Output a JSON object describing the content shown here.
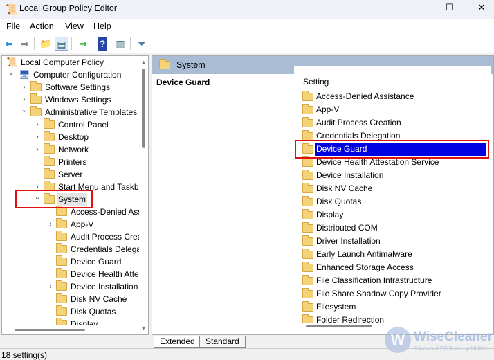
{
  "window": {
    "title": "Local Group Policy Editor",
    "minimize": "—",
    "maximize": "☐",
    "close": "✕"
  },
  "menu": [
    "File",
    "Action",
    "View",
    "Help"
  ],
  "toolbar": {
    "icons": [
      "back-arrow-icon",
      "forward-arrow-icon",
      "up-folder-icon",
      "show-hide-tree-icon",
      "export-list-icon",
      "help-icon",
      "action-pane-icon",
      "filter-icon"
    ]
  },
  "tree": [
    {
      "label": "Local Computer Policy",
      "level": 0,
      "chevron": ""
    },
    {
      "label": "Computer Configuration",
      "level": 1,
      "chevron": "expanded"
    },
    {
      "label": "Software Settings",
      "level": 2,
      "chevron": "collapsed"
    },
    {
      "label": "Windows Settings",
      "level": 2,
      "chevron": "collapsed"
    },
    {
      "label": "Administrative Templates",
      "level": 2,
      "chevron": "expanded"
    },
    {
      "label": "Control Panel",
      "level": 3,
      "chevron": "collapsed"
    },
    {
      "label": "Desktop",
      "level": 3,
      "chevron": "collapsed"
    },
    {
      "label": "Network",
      "level": 3,
      "chevron": "collapsed"
    },
    {
      "label": "Printers",
      "level": 3,
      "chevron": ""
    },
    {
      "label": "Server",
      "level": 3,
      "chevron": ""
    },
    {
      "label": "Start Menu and Taskbar",
      "level": 3,
      "chevron": "collapsed"
    },
    {
      "label": "System",
      "level": 3,
      "chevron": "expanded",
      "selected": true
    },
    {
      "label": "Access-Denied Assistance",
      "level": 4,
      "chevron": ""
    },
    {
      "label": "App-V",
      "level": 4,
      "chevron": "collapsed"
    },
    {
      "label": "Audit Process Creation",
      "level": 4,
      "chevron": ""
    },
    {
      "label": "Credentials Delegation",
      "level": 4,
      "chevron": ""
    },
    {
      "label": "Device Guard",
      "level": 4,
      "chevron": ""
    },
    {
      "label": "Device Health Attestation Service",
      "level": 4,
      "chevron": ""
    },
    {
      "label": "Device Installation",
      "level": 4,
      "chevron": "collapsed"
    },
    {
      "label": "Disk NV Cache",
      "level": 4,
      "chevron": ""
    },
    {
      "label": "Disk Quotas",
      "level": 4,
      "chevron": ""
    },
    {
      "label": "Display",
      "level": 4,
      "chevron": ""
    },
    {
      "label": "Distributed COM",
      "level": 4,
      "chevron": "collapsed"
    }
  ],
  "right": {
    "header": "System",
    "description_title": "Device Guard",
    "column_header": "Setting",
    "items": [
      "Access-Denied Assistance",
      "App-V",
      "Audit Process Creation",
      "Credentials Delegation",
      "Device Guard",
      "Device Health Attestation Service",
      "Device Installation",
      "Disk NV Cache",
      "Disk Quotas",
      "Display",
      "Distributed COM",
      "Driver Installation",
      "Early Launch Antimalware",
      "Enhanced Storage Access",
      "File Classification Infrastructure",
      "File Share Shadow Copy Provider",
      "Filesystem",
      "Folder Redirection"
    ],
    "selected_index": 4
  },
  "tabs": [
    "Extended",
    "Standard"
  ],
  "status": "18 setting(s)",
  "watermark": {
    "brand": "WiseCleaner",
    "tagline": "Advanced PC Tune-up Utilities"
  },
  "colors": {
    "selection": "#0000e0",
    "highlight_box": "#e01010",
    "header_bar": "#a9bcd3"
  }
}
